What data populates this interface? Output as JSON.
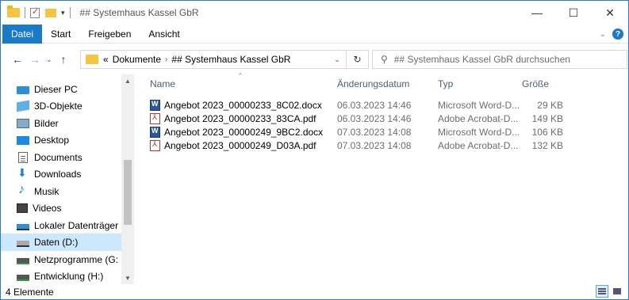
{
  "window": {
    "title": "## Systemhaus Kassel GbR",
    "controls": {
      "minimize": "—",
      "maximize": "☐",
      "close": "✕"
    }
  },
  "ribbon": {
    "tabs": [
      {
        "label": "Datei",
        "active": true
      },
      {
        "label": "Start",
        "active": false
      },
      {
        "label": "Freigeben",
        "active": false
      },
      {
        "label": "Ansicht",
        "active": false
      }
    ],
    "help": "?",
    "expand": "⌄"
  },
  "nav": {
    "back": "←",
    "forward": "→",
    "recent": "⌄",
    "up": "↑"
  },
  "address": {
    "overflow": "«",
    "crumbs": [
      "Dokumente",
      "## Systemhaus Kassel GbR"
    ],
    "separator": "›",
    "dropdown": "⌄",
    "refresh": "↻"
  },
  "search": {
    "placeholder": "## Systemhaus Kassel GbR durchsuchen",
    "icon": "search-icon",
    "glyph": "⚲"
  },
  "sidebar": {
    "items": [
      {
        "label": "Dieser PC",
        "icon": "computer-icon",
        "selected": false
      },
      {
        "label": "3D-Objekte",
        "icon": "3d-objects-icon",
        "selected": false
      },
      {
        "label": "Bilder",
        "icon": "pictures-icon",
        "selected": false
      },
      {
        "label": "Desktop",
        "icon": "desktop-icon",
        "selected": false
      },
      {
        "label": "Documents",
        "icon": "documents-icon",
        "selected": false
      },
      {
        "label": "Downloads",
        "icon": "download-icon",
        "selected": false
      },
      {
        "label": "Musik",
        "icon": "music-icon",
        "selected": false
      },
      {
        "label": "Videos",
        "icon": "videos-icon",
        "selected": false
      },
      {
        "label": "Lokaler Datenträger",
        "icon": "local-drive-icon",
        "selected": false
      },
      {
        "label": "Daten (D:)",
        "icon": "drive-icon",
        "selected": true
      },
      {
        "label": "Netzprogramme (G:",
        "icon": "network-drive-icon",
        "selected": false
      },
      {
        "label": "Entwicklung (H:)",
        "icon": "network-drive-icon",
        "selected": false
      }
    ]
  },
  "filelist": {
    "columns": {
      "name": "Name",
      "modified": "Änderungsdatum",
      "type": "Typ",
      "size": "Größe"
    },
    "rows": [
      {
        "name": "Angebot 2023_00000233_8C02.docx",
        "modified": "06.03.2023 14:46",
        "type": "Microsoft Word-D...",
        "size": "29 KB",
        "kind": "word"
      },
      {
        "name": "Angebot 2023_00000233_83CA.pdf",
        "modified": "06.03.2023 14:46",
        "type": "Adobe Acrobat-D...",
        "size": "149 KB",
        "kind": "pdf"
      },
      {
        "name": "Angebot 2023_00000249_9BC2.docx",
        "modified": "07.03.2023 14:08",
        "type": "Microsoft Word-D...",
        "size": "106 KB",
        "kind": "word"
      },
      {
        "name": "Angebot 2023_00000249_D03A.pdf",
        "modified": "07.03.2023 14:08",
        "type": "Adobe Acrobat-D...",
        "size": "132 KB",
        "kind": "pdf"
      }
    ]
  },
  "status": {
    "count": "4 Elemente"
  },
  "colors": {
    "accent": "#1979ca",
    "selection": "#cce8ff",
    "header_text": "#4c607a",
    "muted_text": "#6d6d6d"
  }
}
